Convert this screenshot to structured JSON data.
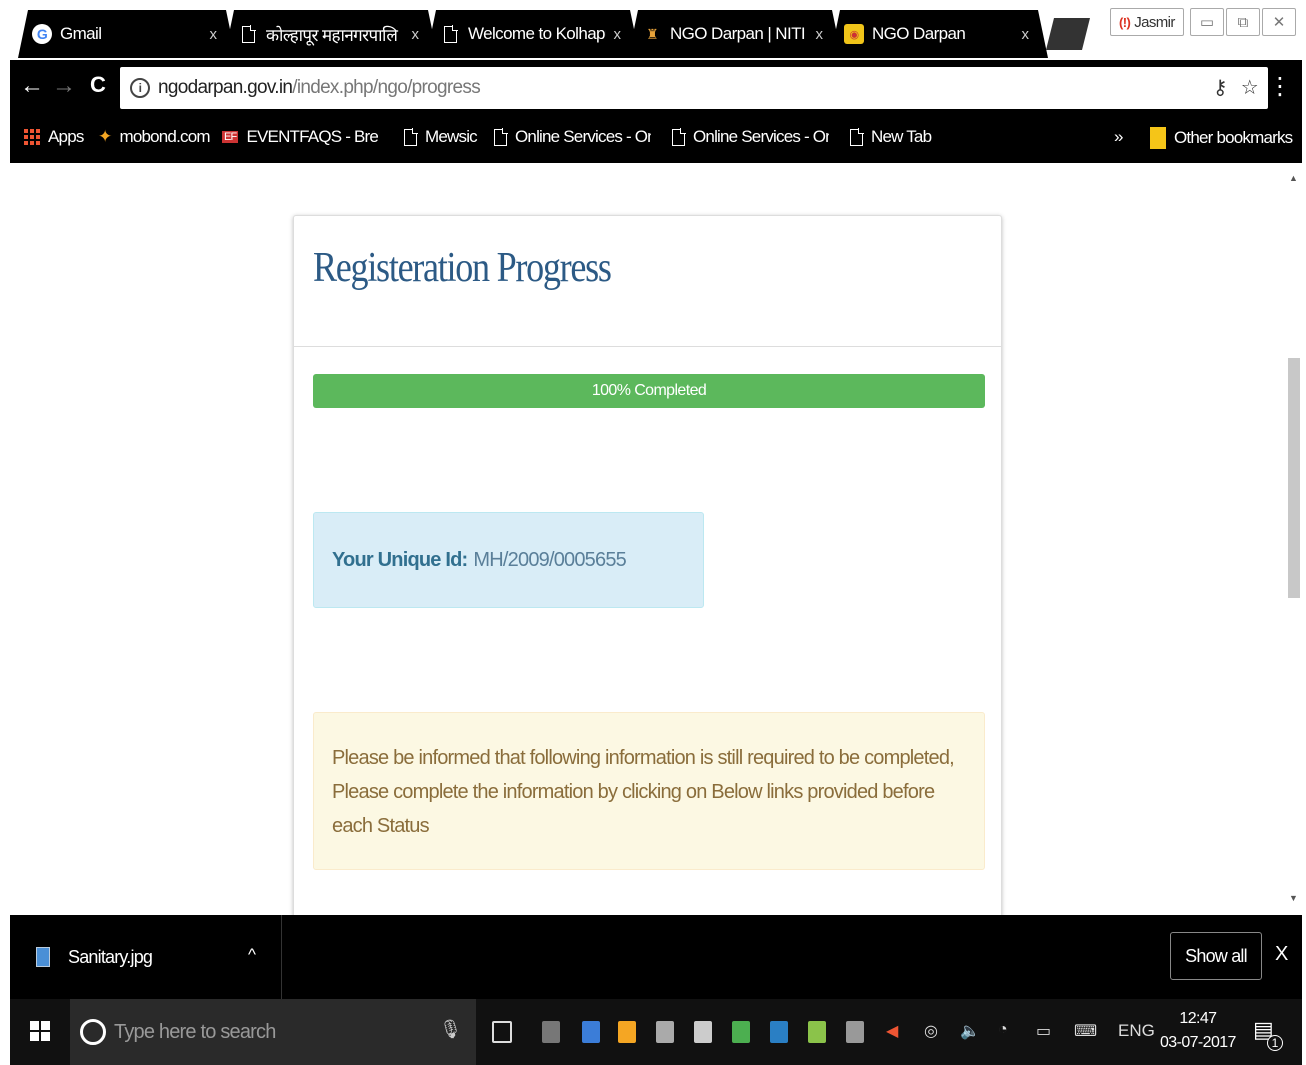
{
  "browser": {
    "tabs": [
      {
        "title": "Gmail",
        "icon": "google-icon",
        "close": "x"
      },
      {
        "title": "कोल्हापूर महानगरपालि",
        "icon": "page-icon",
        "close": "x"
      },
      {
        "title": "Welcome to Kolhapu",
        "icon": "page-icon",
        "close": "x"
      },
      {
        "title": "NGO Darpan | NITI A",
        "icon": "emblem-icon",
        "close": "x"
      },
      {
        "title": "NGO Darpan",
        "icon": "ngo-darpan-icon",
        "close": "x"
      }
    ],
    "profile_name": "Jasmir",
    "window_controls": {
      "minimize": "▭",
      "restore": "⧉",
      "close": "✕"
    },
    "nav": {
      "back": "←",
      "forward": "→",
      "reload": "C"
    },
    "url_host": "ngodarpan.gov.in",
    "url_path": "/index.php/ngo/progress",
    "omnibox_icons": {
      "key": "⚷",
      "star": "☆"
    },
    "menu": "⋮",
    "bookmarks": [
      {
        "label": "Apps",
        "icon": "apps-icon"
      },
      {
        "label": "mobond.com",
        "icon": "mobond-icon"
      },
      {
        "label": "EVENTFAQS - Brett L",
        "icon": "eventfaqs-icon"
      },
      {
        "label": "Mewsic",
        "icon": "page-icon"
      },
      {
        "label": "Online Services - Onl",
        "icon": "page-icon"
      },
      {
        "label": "Online Services - Onl",
        "icon": "page-icon"
      },
      {
        "label": "New Tab",
        "icon": "page-icon"
      }
    ],
    "bookmarks_overflow": "»",
    "other_bookmarks": "Other bookmarks"
  },
  "page": {
    "title": "Registeration Progress",
    "progress_label": "100% Completed",
    "progress_value": 100,
    "progress_color": "#5cb85c",
    "unique_id_label": "Your Unique Id:",
    "unique_id_value": "MH/2009/0005655",
    "notice": "Please be informed that following information is still required to be completed, Please complete the information by clicking on Below links provided before each Status"
  },
  "downloads": {
    "file_name": "Sanitary.jpg",
    "caret": "^",
    "show_all": "Show all",
    "close": "X"
  },
  "taskbar": {
    "search_placeholder": "Type here to search",
    "mic": "🎙",
    "language": "ENG",
    "time": "12:47",
    "date": "03-07-2017",
    "notification_count": "1"
  }
}
